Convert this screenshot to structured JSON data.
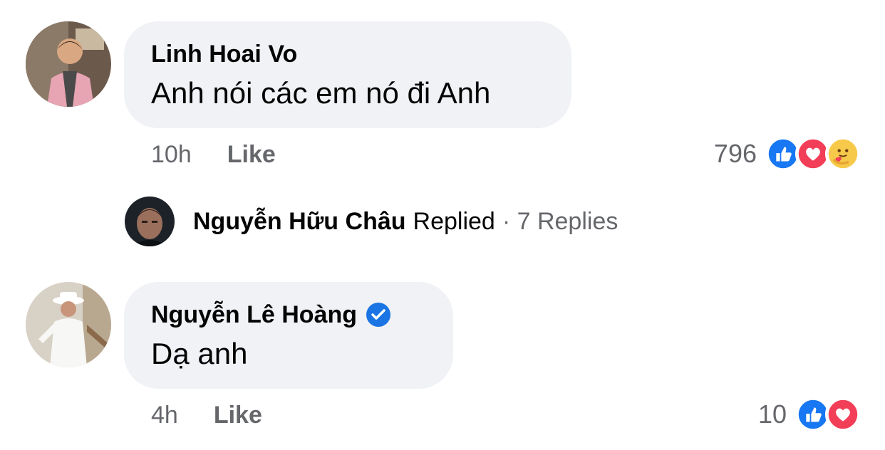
{
  "comments": [
    {
      "author": "Linh Hoai Vo",
      "text": "Anh nói các em nó đi Anh",
      "time": "10h",
      "like_label": "Like",
      "reaction_count": "796",
      "reactions": [
        "like-icon",
        "love-icon",
        "care-icon"
      ],
      "verified": false
    },
    {
      "author": "Nguyễn Lê Hoàng",
      "text": "Dạ anh",
      "time": "4h",
      "like_label": "Like",
      "reaction_count": "10",
      "reactions": [
        "like-icon",
        "love-icon"
      ],
      "verified": true
    }
  ],
  "reply_summary": {
    "name": "Nguyễn Hữu Châu",
    "action": "Replied",
    "count": "· 7 Replies"
  },
  "colors": {
    "bubble": "#f0f2f5",
    "meta_text": "#65676b",
    "like_blue": "#1877f2",
    "love_red": "#f33e58",
    "verified_blue": "#1b74e4"
  }
}
